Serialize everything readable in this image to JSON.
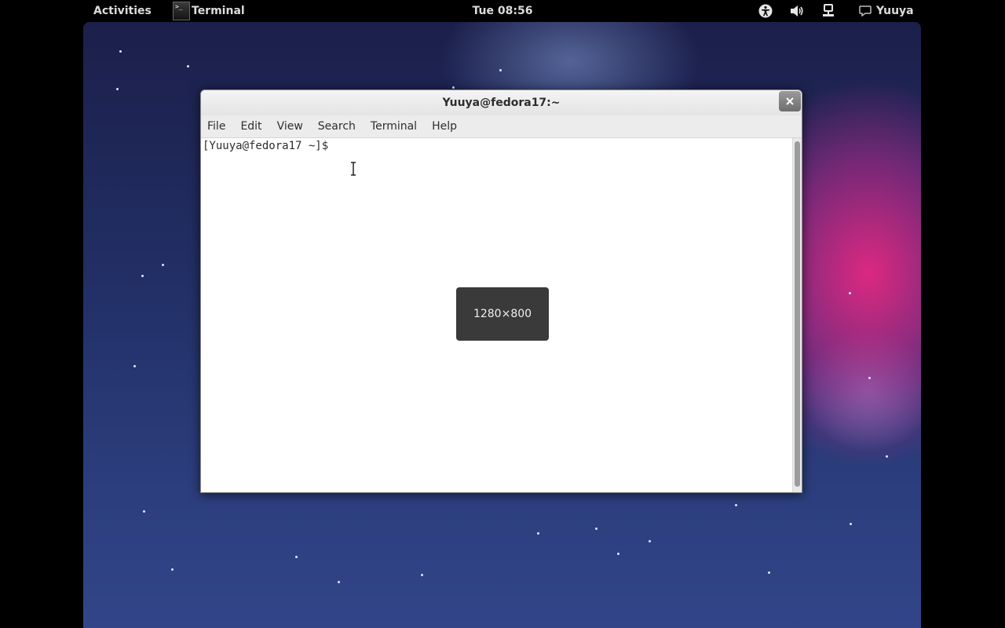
{
  "topbar": {
    "activities": "Activities",
    "app_name": "Terminal",
    "clock": "Tue 08:56",
    "user": "Yuuya",
    "tray_icons": [
      "accessibility-icon",
      "volume-icon",
      "network-icon",
      "chat-icon"
    ]
  },
  "terminal": {
    "title": "Yuuya@fedora17:~",
    "menu": [
      "File",
      "Edit",
      "View",
      "Search",
      "Terminal",
      "Help"
    ],
    "prompt": "[Yuuya@fedora17 ~]$"
  },
  "osd": {
    "size_label": "1280×800"
  }
}
